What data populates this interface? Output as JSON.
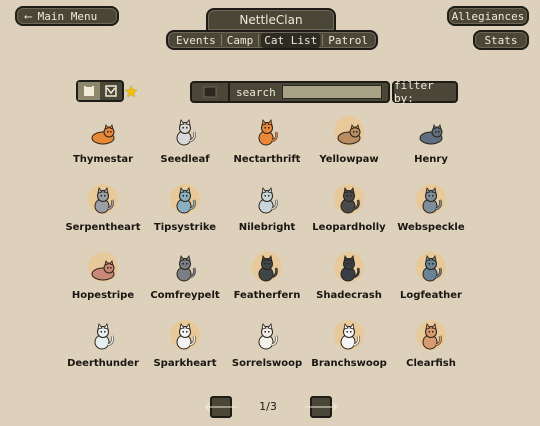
{
  "header": {
    "main_menu_label": "Main Menu",
    "clan_name": "NettleClan",
    "allegiances_label": "Allegiances",
    "stats_label": "Stats"
  },
  "nav": {
    "tabs": [
      {
        "label": "Events"
      },
      {
        "label": "Camp"
      },
      {
        "label": "Cat List",
        "active": true
      },
      {
        "label": "Patrol"
      }
    ]
  },
  "search": {
    "label": "search",
    "value": "",
    "filter_label": "filter by:"
  },
  "cats": [
    {
      "name": "Thymestar",
      "color": "#e8893a",
      "highlight": false,
      "pose": "lying"
    },
    {
      "name": "Seedleaf",
      "color": "#d8d8d8",
      "highlight": false,
      "pose": "sitting"
    },
    {
      "name": "Nectarthrift",
      "color": "#e8893a",
      "highlight": false,
      "pose": "sitting"
    },
    {
      "name": "Yellowpaw",
      "color": "#b98d62",
      "highlight": true,
      "pose": "lying"
    },
    {
      "name": "Henry",
      "color": "#5f6e80",
      "highlight": false,
      "pose": "lying"
    },
    {
      "name": "Serpentheart",
      "color": "#9c9ea6",
      "highlight": true,
      "pose": "sitting"
    },
    {
      "name": "Tipsystrike",
      "color": "#8ab0bf",
      "highlight": true,
      "pose": "sitting"
    },
    {
      "name": "Nilebright",
      "color": "#c8d6dc",
      "highlight": false,
      "pose": "sitting"
    },
    {
      "name": "Leopardholly",
      "color": "#4a4a4a",
      "highlight": true,
      "pose": "sitting"
    },
    {
      "name": "Webspeckle",
      "color": "#7d8d9c",
      "highlight": true,
      "pose": "sitting"
    },
    {
      "name": "Hopestripe",
      "color": "#c98878",
      "highlight": true,
      "pose": "lying"
    },
    {
      "name": "Comfreypelt",
      "color": "#7a7f86",
      "highlight": false,
      "pose": "sitting"
    },
    {
      "name": "Featherfern",
      "color": "#3f4648",
      "highlight": true,
      "pose": "sitting"
    },
    {
      "name": "Shadecrash",
      "color": "#3a3e44",
      "highlight": true,
      "pose": "sitting"
    },
    {
      "name": "Logfeather",
      "color": "#6a8396",
      "highlight": true,
      "pose": "sitting"
    },
    {
      "name": "Deerthunder",
      "color": "#e6eef0",
      "highlight": false,
      "pose": "sitting"
    },
    {
      "name": "Sparkheart",
      "color": "#f2f2f2",
      "highlight": true,
      "pose": "sitting"
    },
    {
      "name": "Sorrelswoop",
      "color": "#f4f0ea",
      "highlight": false,
      "pose": "sitting"
    },
    {
      "name": "Branchswoop",
      "color": "#f6f6f6",
      "highlight": true,
      "pose": "sitting"
    },
    {
      "name": "Clearfish",
      "color": "#d99a72",
      "highlight": true,
      "pose": "sitting"
    }
  ],
  "pagination": {
    "indicator": "1/3",
    "prev_icon": "arrow-left",
    "next_icon": "arrow-right"
  },
  "colors": {
    "background": "#ddd1bc",
    "button": "#4a4739",
    "highlight": "#e8c99a"
  }
}
